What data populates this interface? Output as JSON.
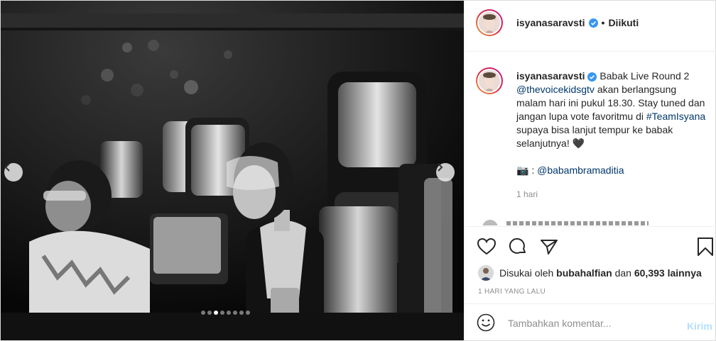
{
  "post": {
    "author": "isyanasaravsti",
    "follow_separator": "•",
    "follow_label": "Diikuti",
    "caption_text_1": "Babak Live Round 2",
    "caption_mention": "@thevoicekidsgtv",
    "caption_text_2": "akan berlangsung malam hari ini pukul 18.30. Stay tuned dan jangan lupa vote favoritmu di",
    "caption_hashtag": "#TeamIsyana",
    "caption_text_3": "supaya bisa lanjut tempur ke babak selanjutnya!",
    "caption_heart": "🖤",
    "camera_icon_glyph": "📷",
    "photo_credit_sep": ":",
    "photo_credit": "@babambramaditia",
    "caption_time": "1 hari",
    "liked_by_prefix": "Disukai oleh",
    "liked_by_user": "bubahalfian",
    "liked_by_and": "dan",
    "liked_by_count": "60,393 lainnya",
    "posted_ago": "1 HARI YANG LALU"
  },
  "comment_box": {
    "placeholder": "Tambahkan komentar...",
    "post_label": "Kirim"
  },
  "carousel": {
    "slide_count": 8,
    "active_index": 2
  },
  "colors": {
    "link": "#00376b",
    "verified": "#3897f0",
    "muted": "#8e8e8e",
    "post_disabled": "#b2dffc"
  }
}
